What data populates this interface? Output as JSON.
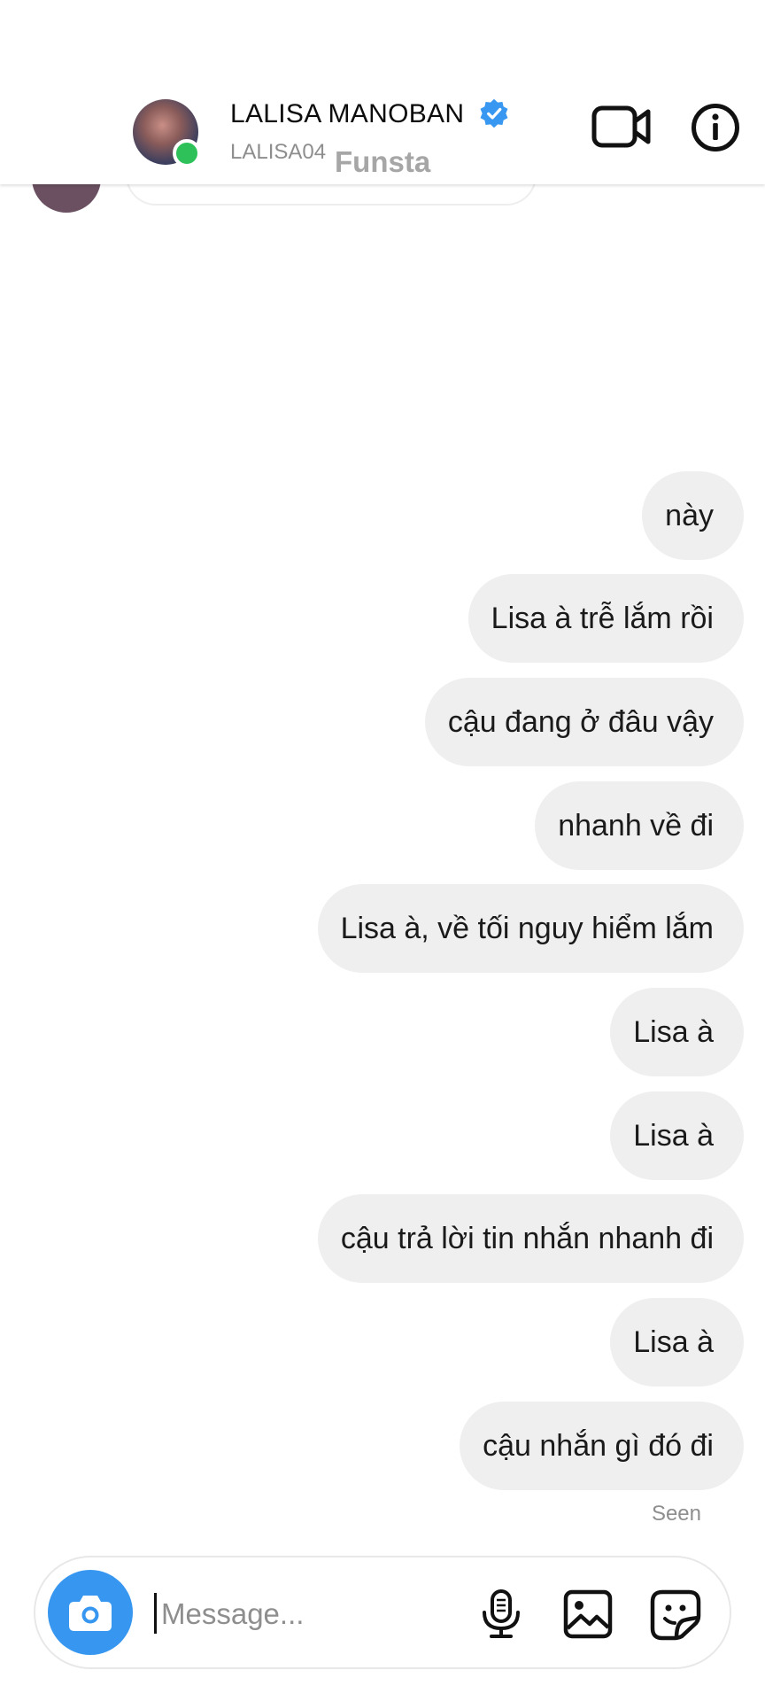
{
  "header": {
    "name": "LALISA MANOBAN",
    "username": "LALISA04",
    "watermark": "Funsta",
    "verified_icon": "verified-badge-icon",
    "video_icon": "video-camera-icon",
    "info_icon": "info-icon",
    "online_color": "#2ec15a",
    "verified_color": "#3897f0"
  },
  "messages": [
    {
      "text": "này"
    },
    {
      "text": "Lisa à trễ lắm rồi"
    },
    {
      "text": "cậu đang ở đâu vậy"
    },
    {
      "text": "nhanh về đi"
    },
    {
      "text": "Lisa à, về tối nguy hiểm lắm"
    },
    {
      "text": "Lisa à"
    },
    {
      "text": "Lisa à"
    },
    {
      "text": "cậu trả lời tin nhắn nhanh đi"
    },
    {
      "text": "Lisa à"
    },
    {
      "text": "cậu nhắn gì đó đi"
    }
  ],
  "seen_label": "Seen",
  "composer": {
    "placeholder": "Message...",
    "camera_icon": "camera-icon",
    "mic_icon": "microphone-icon",
    "gallery_icon": "image-icon",
    "sticker_icon": "sticker-icon",
    "accent": "#3797f0"
  },
  "colors": {
    "bubble": "#efefef",
    "background": "#ffffff"
  }
}
